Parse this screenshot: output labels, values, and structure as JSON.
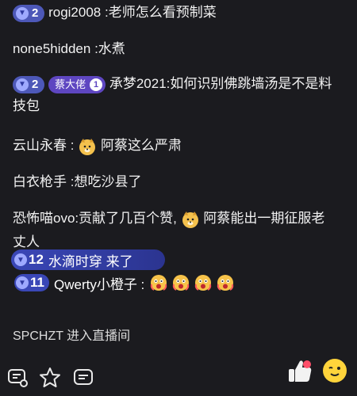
{
  "chat": {
    "msg1": {
      "level": "2",
      "user": "rogi2008",
      "text": ":老师怎么看预制菜"
    },
    "msg2": {
      "user": "none5hidden",
      "text": ":水煮"
    },
    "msg3": {
      "level": "2",
      "fan_name": "蔡大佬",
      "fan_level": "1",
      "user": "承梦2021",
      "text": ":如何识别佛跳墙汤是不是料",
      "text_cont": "技包"
    },
    "msg4": {
      "user": "云山永春",
      "text": "阿蔡这么严肃"
    },
    "msg5": {
      "user": "白衣枪手",
      "text": ":想吃沙县了"
    },
    "msg6": {
      "user": "恐怖喵ovo",
      "text": ":贡献了几百个赞,",
      "text2": "阿蔡能出一期征服老",
      "text_cont": "丈人"
    },
    "hl1": {
      "level": "12",
      "text": "水滴时穿  来了"
    },
    "hl2": {
      "level": "11",
      "text": "Qwerty小橙子 :"
    },
    "entry": {
      "text": "SPCHZT 进入直播间"
    }
  },
  "toolbar": {
    "icons": [
      "chat-settings-icon",
      "star-icon",
      "message-icon",
      "thumbs-up-icon",
      "emoji-wink-icon"
    ]
  }
}
